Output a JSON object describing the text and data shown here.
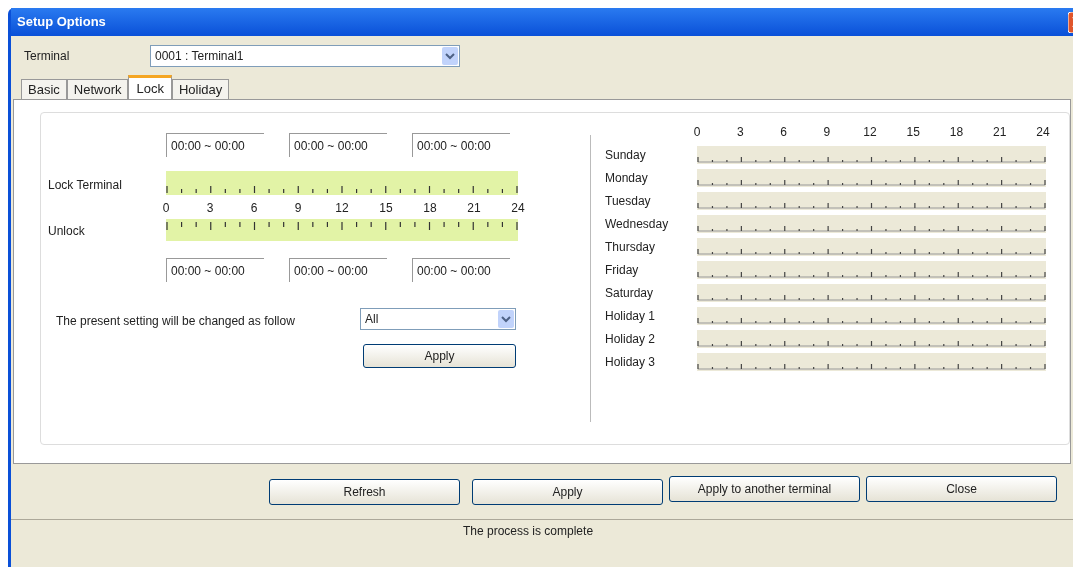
{
  "window": {
    "title": "Setup Options"
  },
  "terminal": {
    "label": "Terminal",
    "value": "0001 : Terminal1"
  },
  "tabs": [
    {
      "label": "Basic",
      "selected": false
    },
    {
      "label": "Network",
      "selected": false
    },
    {
      "label": "Lock",
      "selected": true
    },
    {
      "label": "Holiday",
      "selected": false
    }
  ],
  "lock_panel": {
    "lock_times": [
      "00:00 ~ 00:00",
      "00:00 ~ 00:00",
      "00:00 ~ 00:00"
    ],
    "lock_label": "Lock Terminal",
    "hour_labels": [
      "0",
      "3",
      "6",
      "9",
      "12",
      "15",
      "18",
      "21",
      "24"
    ],
    "unlock_label": "Unlock",
    "unlock_times": [
      "00:00 ~ 00:00",
      "00:00 ~ 00:00",
      "00:00 ~ 00:00"
    ],
    "scope_label": "The present setting will be changed as follow",
    "scope_value": "All",
    "apply_button": "Apply"
  },
  "week_schedule": {
    "hour_labels": [
      "0",
      "3",
      "6",
      "9",
      "12",
      "15",
      "18",
      "21",
      "24"
    ],
    "days": [
      "Sunday",
      "Monday",
      "Tuesday",
      "Wednesday",
      "Thursday",
      "Friday",
      "Saturday",
      "Holiday 1",
      "Holiday 2",
      "Holiday 3"
    ]
  },
  "buttons": [
    "Refresh",
    "Apply",
    "Apply to another terminal",
    "Close"
  ],
  "status_bar": "The process is complete"
}
